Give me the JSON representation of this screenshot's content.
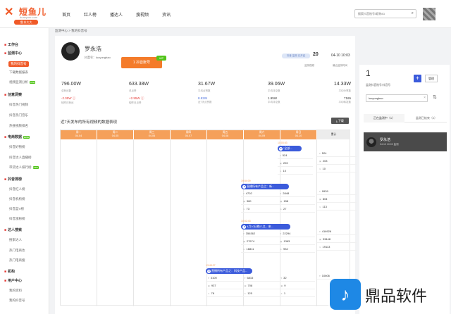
{
  "brand": {
    "name": "短鱼儿",
    "domain": "duanyuer.com",
    "badge": "懂 抖大大"
  },
  "nav": [
    "首页",
    "红人榜",
    "播达人",
    "搜视频",
    "资讯"
  ],
  "search": {
    "placeholder": "搜索抖音账号/昵称/ID"
  },
  "sidebar": {
    "groups": [
      {
        "label": "工作台",
        "items": []
      },
      {
        "label": "监测中心",
        "items": [
          "我的抖音号",
          "下载数据报表",
          "视频监测分析"
        ]
      },
      {
        "label": "创意洞察",
        "items": [
          "抖音热门视频",
          "抖音热门音乐",
          "热搜视频排名"
        ]
      },
      {
        "label": "电商数据",
        "items": [
          "抖音好物榜",
          "抖音达人直播榜",
          "带货达人排行榜"
        ]
      },
      {
        "label": "抖音排榜",
        "items": [
          "抖音红人榜",
          "抖音机构榜",
          "抖音蓝V榜",
          "抖音涨粉榜"
        ]
      },
      {
        "label": "达人搜索",
        "items": [
          "搜索达人",
          "热门电商达",
          "热门电商搜"
        ]
      },
      {
        "label": "机构",
        "items": []
      },
      {
        "label": "用户中心",
        "items": [
          "我的资料",
          "我的抖音号"
        ]
      }
    ],
    "new_tag": "new"
  },
  "breadcrumb": "监测中心 > 我的抖音号",
  "profile": {
    "name": "罗永浩",
    "id": "抖音号：luoyonghao",
    "button": "1 抖音账号",
    "vip": "VIP",
    "tag": "抖音 监测 已开启",
    "count": "20",
    "count_label": "监测视频",
    "time": "04-10 10:03",
    "time_label": "最近监测时间"
  },
  "stats": [
    {
      "value": "796.00W",
      "label": "总粉丝数",
      "delta": "-2.05W ⓘ",
      "delta_label": "较昨日粉丝",
      "cls": "red"
    },
    {
      "value": "633.38W",
      "label": "总点赞",
      "delta": "+2.95W ⓘ",
      "delta_label": "较昨日点赞",
      "cls": "red"
    },
    {
      "value": "31.67W",
      "label": "平均点赞数",
      "delta": "8.92W",
      "delta_label": "近7天点赞数",
      "cls": "blue"
    },
    {
      "value": "39.06W",
      "label": "平均评论数",
      "delta": "1.95W",
      "delta_label": "平均评论数",
      "cls": "dark"
    },
    {
      "value": "14.33W",
      "label": "平均分享数",
      "delta": "7165",
      "delta_label": "平均转发数",
      "cls": "dark"
    }
  ],
  "panel": {
    "title": "近7天发布的所有视频的数据表现",
    "download": "⤓ 下载"
  },
  "columns": [
    {
      "day": "周一",
      "date": "04.04"
    },
    {
      "day": "周二",
      "date": "04.05"
    },
    {
      "day": "周三",
      "date": "04.06"
    },
    {
      "day": "周四",
      "date": "04.07"
    },
    {
      "day": "周五",
      "date": "04.08"
    },
    {
      "day": "周六",
      "date": "04.09"
    },
    {
      "day": "周日",
      "date": "04.10"
    },
    {
      "day": "累计",
      "date": ""
    }
  ],
  "videos": [
    {
      "time": "10:03:53",
      "title": "“全部...",
      "likes": "524",
      "comments": "203",
      "shares": "10",
      "tot_likes": "524",
      "tot_comments": "203",
      "tot_shares": "10"
    },
    {
      "time": "19:54:09",
      "title": "直播所有产品之：新...",
      "likes": "4702",
      "comments": "360",
      "shares": "73",
      "p_likes": "2848",
      "p_comments": "158",
      "p_shares": "27",
      "tot_likes": "9939",
      "tot_comments": "804",
      "tot_shares": "113"
    },
    {
      "time": "10:52:43",
      "title": "4月10日晚八点，来...",
      "likes": "356362",
      "comments": "27974",
      "shares": "16811",
      "p_likes": "22294",
      "p_comments": "1363",
      "p_shares": "932",
      "tot_likes": "416926",
      "tot_comments": "33448",
      "tot_shares": "19113"
    },
    {
      "time": "13:48:27",
      "title": "直播所有产品之：科技产品...",
      "likes": "3100",
      "comments": "937",
      "shares": "78",
      "p_likes": "6815",
      "p_comments": "708",
      "p_shares": "125",
      "q_likes": "32",
      "q_comments": "9",
      "q_shares": "1",
      "tot_likes": "10606",
      "tot_comments": "",
      "tot_shares": ""
    }
  ],
  "right": {
    "count": "1",
    "count_label": "监测抖音账号/抖音号",
    "add": "+",
    "manage": "管理",
    "search_value": "luoyonghao",
    "tabs": [
      "正在监测中（1）",
      "监测已结束（0）"
    ],
    "item": {
      "name": "罗永浩",
      "time": "04-10 10:03 监测"
    }
  },
  "watermark": {
    "text": "鼎品软件"
  }
}
